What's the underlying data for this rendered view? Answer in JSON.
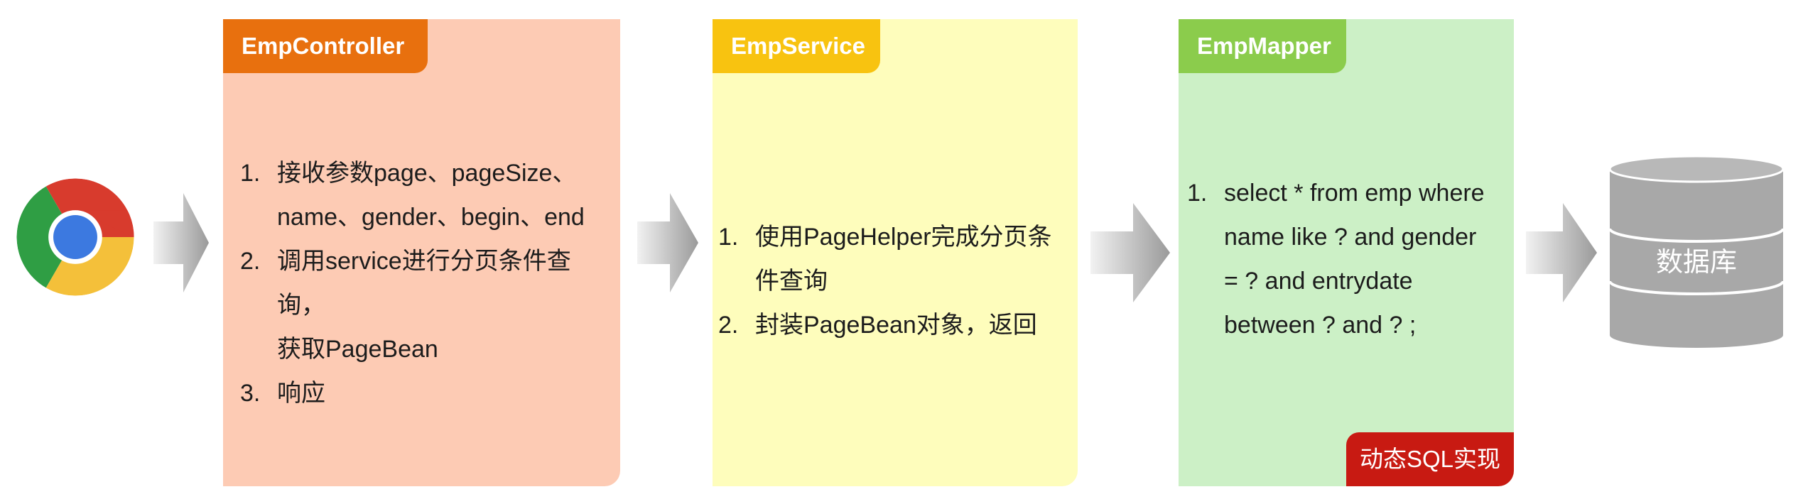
{
  "diagram": {
    "client_icon": "chrome-browser-icon",
    "database_icon": "database-cylinder-icon",
    "panels": {
      "controller": {
        "title": "EmpController",
        "color": "#e8700e",
        "background": "#fdcbb4",
        "steps": [
          {
            "num": "1.",
            "lines": [
              "接收参数page、pageSize、",
              "name、gender、begin、end"
            ]
          },
          {
            "num": "2.",
            "lines": [
              "调用service进行分页条件查询，",
              "获取PageBean"
            ]
          },
          {
            "num": "3.",
            "lines": [
              "响应"
            ]
          }
        ]
      },
      "service": {
        "title": "EmpService",
        "color": "#f8c310",
        "background": "#fefdbc",
        "steps": [
          {
            "num": "1.",
            "lines": [
              "使用PageHelper完成分页条",
              "件查询"
            ]
          },
          {
            "num": "2.",
            "lines": [
              "封装PageBean对象，返回"
            ]
          }
        ]
      },
      "mapper": {
        "title": "EmpMapper",
        "color": "#8bcc4c",
        "background": "#ccf0c6",
        "steps": [
          {
            "num": "1.",
            "lines": [
              "select * from emp where",
              "name like ? and gender",
              "= ? and entrydate",
              "between ? and ? ;"
            ]
          }
        ],
        "badge": {
          "label": "动态SQL实现",
          "color": "#c81a12"
        }
      }
    },
    "database": {
      "label": "数据库",
      "color": "#a8a8a8"
    }
  }
}
